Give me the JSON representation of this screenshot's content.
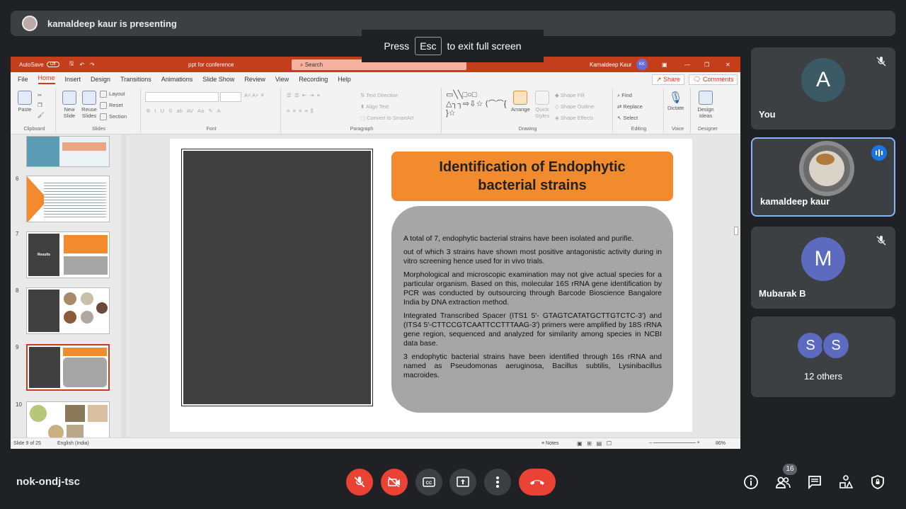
{
  "presenter_bar": {
    "text": "kamaldeep kaur is presenting"
  },
  "esc_tip": {
    "press": "Press",
    "key": "Esc",
    "rest": "to exit full screen"
  },
  "ppt": {
    "autosave": "AutoSave",
    "autosave_state": "Off",
    "doc_title": "ppt for conference",
    "search_placeholder": "Search",
    "user_name": "Kamaldeep Kaur",
    "user_initials": "KK",
    "tabs": [
      "File",
      "Home",
      "Insert",
      "Design",
      "Transitions",
      "Animations",
      "Slide Show",
      "Review",
      "View",
      "Recording",
      "Help"
    ],
    "active_tab": "Home",
    "share": "Share",
    "comments": "Comments",
    "ribbon": {
      "clipboard": {
        "label": "Clipboard",
        "paste": "Paste"
      },
      "slides": {
        "label": "Slides",
        "new_slide": "New Slide",
        "reuse_slides": "Reuse Slides",
        "layout": "Layout",
        "reset": "Reset",
        "section": "Section"
      },
      "font": {
        "label": "Font"
      },
      "paragraph": {
        "label": "Paragraph",
        "text_direction": "Text Direction",
        "align_text": "Align Text",
        "convert_smartart": "Convert to SmartArt"
      },
      "drawing": {
        "label": "Drawing",
        "arrange": "Arrange",
        "quick_styles": "Quick Styles",
        "shape_fill": "Shape Fill",
        "shape_outline": "Shape Outline",
        "shape_effects": "Shape Effects"
      },
      "editing": {
        "label": "Editing",
        "find": "Find",
        "replace": "Replace",
        "select": "Select"
      },
      "voice": {
        "label": "Voice",
        "dictate": "Dictate"
      },
      "designer": {
        "label": "Designer",
        "design_ideas": "Design Ideas"
      }
    },
    "thumbnails": [
      {
        "num": "6"
      },
      {
        "num": "7",
        "label": "Results"
      },
      {
        "num": "8"
      },
      {
        "num": "9"
      },
      {
        "num": "10"
      }
    ],
    "slide": {
      "title": "Identification of Endophytic bacterial strains",
      "paragraphs": [
        "A total of 7, endophytic bacterial strains have been isolated and purifie.",
        "out of which 3 strains have shown most positive antagonistic activity during in vitro screening hence used for in vivo trials.",
        "Morphological and microscopic examination may not give actual species for a particular organism. Based on this, molecular 16S rRNA gene identification by PCR was conducted by outsourcing through Barcode Bioscience Bangalore India by DNA extraction method.",
        " Integrated Transcribed Spacer (ITS1 5′- GTAGTCATATGCTTGTCTC-3′) and (ITS4 5′-CTTCCGTCAATTCCTTTAAG-3′) primers were amplified by 18S rRNA gene region, sequenced and analyzed for similarity among species in NCBI data base.",
        "3 endophytic bacterial strains have been identified through 16s rRNA and named as Pseudomonas aeruginosa, Bacillus subtilis, Lysinibacillus macroides."
      ]
    },
    "status": {
      "slide": "Slide 9 of 25",
      "language": "English (India)",
      "notes": "Notes",
      "zoom": "86%"
    }
  },
  "participants": [
    {
      "name": "You",
      "initial": "A",
      "color": "#3c5a66",
      "muted": true
    },
    {
      "name": "kamaldeep kaur",
      "speaking": true
    },
    {
      "name": "Mubarak B",
      "initial": "M",
      "color": "#5c6bc0",
      "muted": true
    },
    {
      "name": "12 others",
      "initials": [
        "S",
        "S"
      ]
    }
  ],
  "bottom": {
    "meeting_code": "nok-ondj-tsc",
    "participant_count": "16",
    "colors": {
      "end_call": "#ea4335",
      "muted": "#ea4335",
      "neutral": "#3c4043"
    }
  }
}
